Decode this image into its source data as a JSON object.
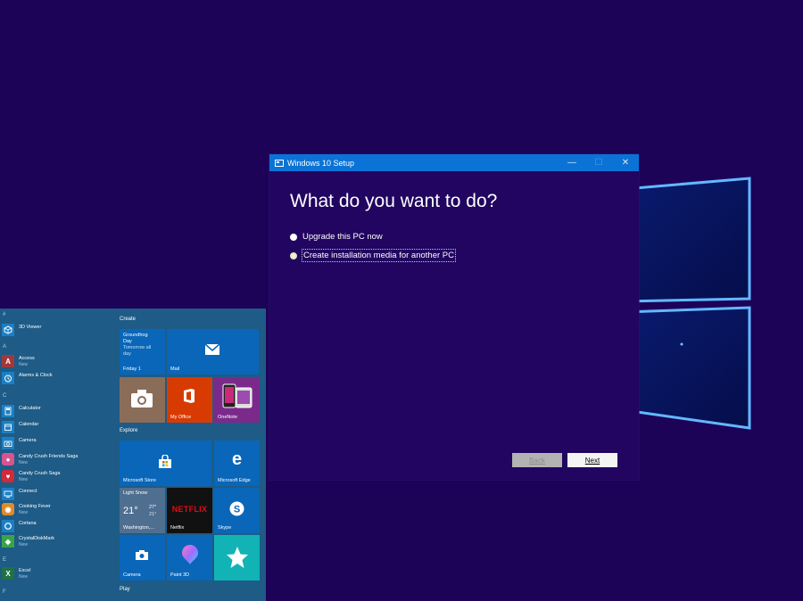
{
  "dialog": {
    "title": "Windows 10 Setup",
    "heading": "What do you want to do?",
    "options": [
      {
        "label": "Upgrade this PC now",
        "selected": false
      },
      {
        "label": "Create installation media for another PC",
        "selected": true
      }
    ],
    "back_label": "Back",
    "next_label": "Next",
    "controls": {
      "minimize": "—",
      "maximize": "☐",
      "close": "✕"
    }
  },
  "start_menu": {
    "letters": [
      "#",
      "A",
      "C",
      "E",
      "F"
    ],
    "apps": [
      {
        "name": "3D Viewer",
        "badge": "",
        "icon": "cube-icon",
        "color": "#1c7fc3"
      },
      {
        "name": "Access",
        "badge": "New",
        "icon": "access-icon",
        "color": "#a4373a"
      },
      {
        "name": "Alarms & Clock",
        "badge": "",
        "icon": "alarm-icon",
        "color": "#1c7fc3"
      },
      {
        "name": "Calculator",
        "badge": "",
        "icon": "calculator-icon",
        "color": "#1c7fc3"
      },
      {
        "name": "Calendar",
        "badge": "",
        "icon": "calendar-icon",
        "color": "#1c7fc3"
      },
      {
        "name": "Camera",
        "badge": "",
        "icon": "camera-icon",
        "color": "#1c7fc3"
      },
      {
        "name": "Candy Crush Friends Saga",
        "badge": "New",
        "icon": "candy-icon",
        "color": "#d8548f"
      },
      {
        "name": "Candy Crush Saga",
        "badge": "New",
        "icon": "candy-icon",
        "color": "#d02b3a"
      },
      {
        "name": "Connect",
        "badge": "",
        "icon": "connect-icon",
        "color": "#1c7fc3"
      },
      {
        "name": "Cooking Fever",
        "badge": "New",
        "icon": "cooking-icon",
        "color": "#e08a2c"
      },
      {
        "name": "Cortana",
        "badge": "",
        "icon": "cortana-icon",
        "color": "#1c7fc3"
      },
      {
        "name": "CrystalDiskMark",
        "badge": "New",
        "icon": "disk-icon",
        "color": "#3aa348"
      },
      {
        "name": "Excel",
        "badge": "New",
        "icon": "excel-icon",
        "color": "#1f7244"
      }
    ],
    "groups": [
      "Create",
      "Explore",
      "Play"
    ],
    "tiles": {
      "calendar": {
        "line1": "Groundhog",
        "line2": "Day",
        "line3": "Tomorrow all",
        "line4": "day",
        "date": "Friday 1"
      },
      "mail": "Mail",
      "myoffice": "My Office",
      "onenote": "OneNote",
      "store": "Microsoft Store",
      "edge": "Microsoft Edge",
      "weather": {
        "condition": "Light Snow",
        "temp": "21°",
        "high": "27°",
        "low": "21°",
        "place": "Washington,..."
      },
      "netflix": {
        "logo": "NETFLIX",
        "label": "Netflix"
      },
      "skype": "Skype",
      "camera": "Camera",
      "paint3d": "Paint 3D"
    }
  },
  "colors": {
    "desktop": "#1c0358",
    "dialog_bg": "#210560",
    "titlebar": "#0b73d6",
    "start_bg": "#1e5b86",
    "tile_blue": "#0a66b8"
  }
}
